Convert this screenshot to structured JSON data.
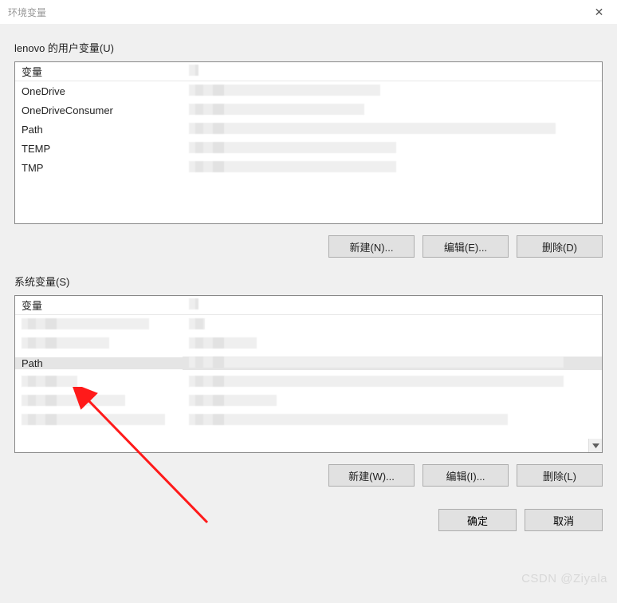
{
  "titlebar": {
    "title": "环境变量",
    "close_icon": "✕"
  },
  "user_section": {
    "label": "lenovo 的用户变量(U)",
    "header_var": "变量",
    "rows": [
      {
        "name": "OneDrive"
      },
      {
        "name": "OneDriveConsumer"
      },
      {
        "name": "Path"
      },
      {
        "name": "TEMP"
      },
      {
        "name": "TMP"
      }
    ],
    "new_label": "新建(N)...",
    "edit_label": "编辑(E)...",
    "delete_label": "删除(D)"
  },
  "system_section": {
    "label": "系统变量(S)",
    "header_var": "变量",
    "rows": [
      {
        "name": "",
        "redacted": true
      },
      {
        "name": "",
        "redacted": true
      },
      {
        "name": "Path",
        "selected": true
      },
      {
        "name": "",
        "redacted": true
      },
      {
        "name": "",
        "redacted": true
      },
      {
        "name": "",
        "redacted": true
      }
    ],
    "new_label": "新建(W)...",
    "edit_label": "编辑(I)...",
    "delete_label": "删除(L)"
  },
  "footer": {
    "ok_label": "确定",
    "cancel_label": "取消"
  },
  "watermark": "CSDN @Ziyala"
}
